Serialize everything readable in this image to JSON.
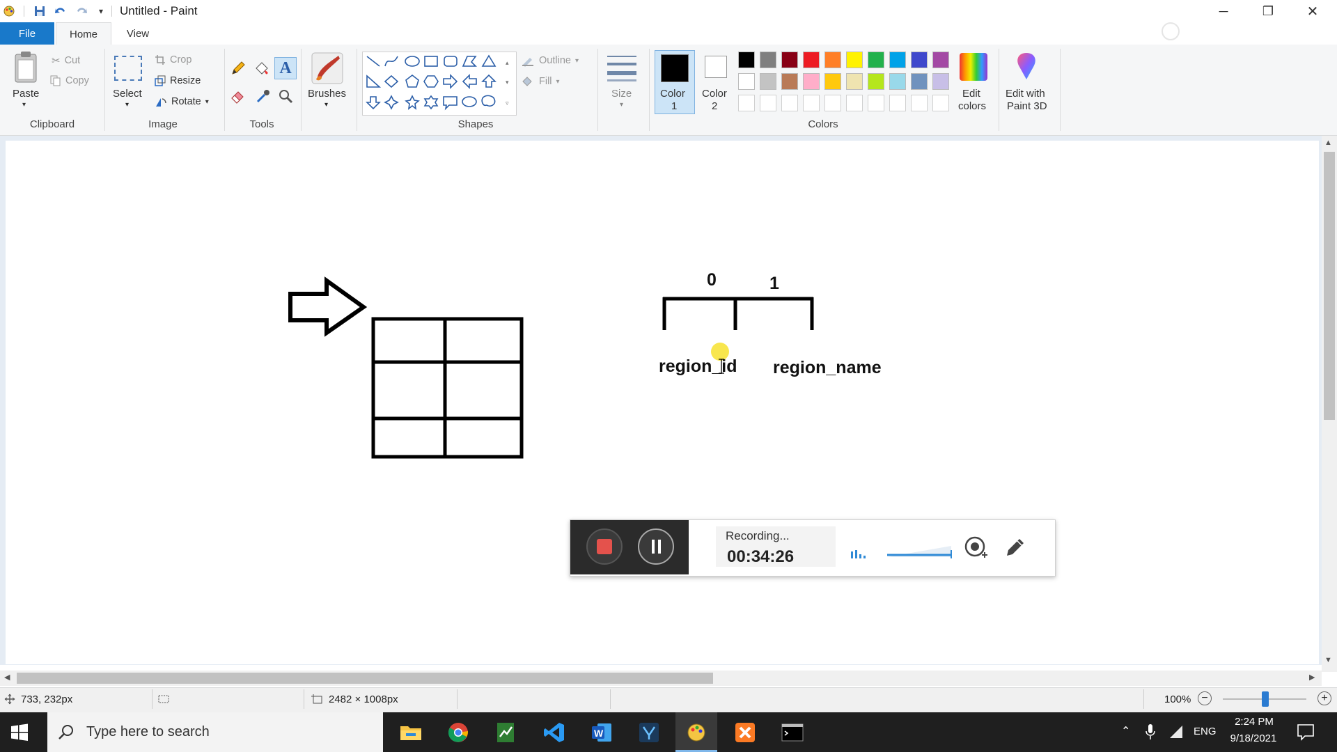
{
  "window": {
    "title": "Untitled - Paint",
    "controls": {
      "minimize": "─",
      "restore": "❐",
      "close": "✕"
    }
  },
  "tabs": {
    "file": "File",
    "home": "Home",
    "view": "View"
  },
  "ribbon": {
    "clipboard": {
      "group": "Clipboard",
      "paste": "Paste",
      "cut": "Cut",
      "copy": "Copy"
    },
    "image": {
      "group": "Image",
      "select": "Select",
      "crop": "Crop",
      "resize": "Resize",
      "rotate": "Rotate"
    },
    "tools": {
      "group": "Tools"
    },
    "brushes": {
      "label": "Brushes"
    },
    "shapes": {
      "group": "Shapes",
      "outline": "Outline",
      "fill": "Fill"
    },
    "size": {
      "label": "Size"
    },
    "colors": {
      "group": "Colors",
      "color1": "Color",
      "color1_num": "1",
      "color2": "Color",
      "color2_num": "2",
      "edit_colors_1": "Edit",
      "edit_colors_2": "colors",
      "edit3d_1": "Edit with",
      "edit3d_2": "Paint 3D",
      "palette_row1": [
        "#000000",
        "#7f7f7f",
        "#880015",
        "#ed1c24",
        "#ff7f27",
        "#fff200",
        "#22b14c",
        "#00a2e8",
        "#3f48cc",
        "#a349a4"
      ],
      "palette_row2": [
        "#ffffff",
        "#c3c3c3",
        "#b97a57",
        "#ffaec9",
        "#ffc90e",
        "#efe4b0",
        "#b5e61d",
        "#99d9ea",
        "#7092be",
        "#c8bfe7"
      ]
    }
  },
  "canvas": {
    "index_0": "0",
    "index_1": "1",
    "label_region_id": "region_id",
    "label_region_name": "region_name"
  },
  "recorder": {
    "status": "Recording...",
    "time": "00:34:26"
  },
  "statusbar": {
    "cursor_pos": "733, 232px",
    "image_size": "2482 × 1008px",
    "zoom": "100%"
  },
  "taskbar": {
    "search_placeholder": "Type here to search",
    "language": "ENG",
    "time": "2:24 PM",
    "date": "9/18/2021"
  }
}
